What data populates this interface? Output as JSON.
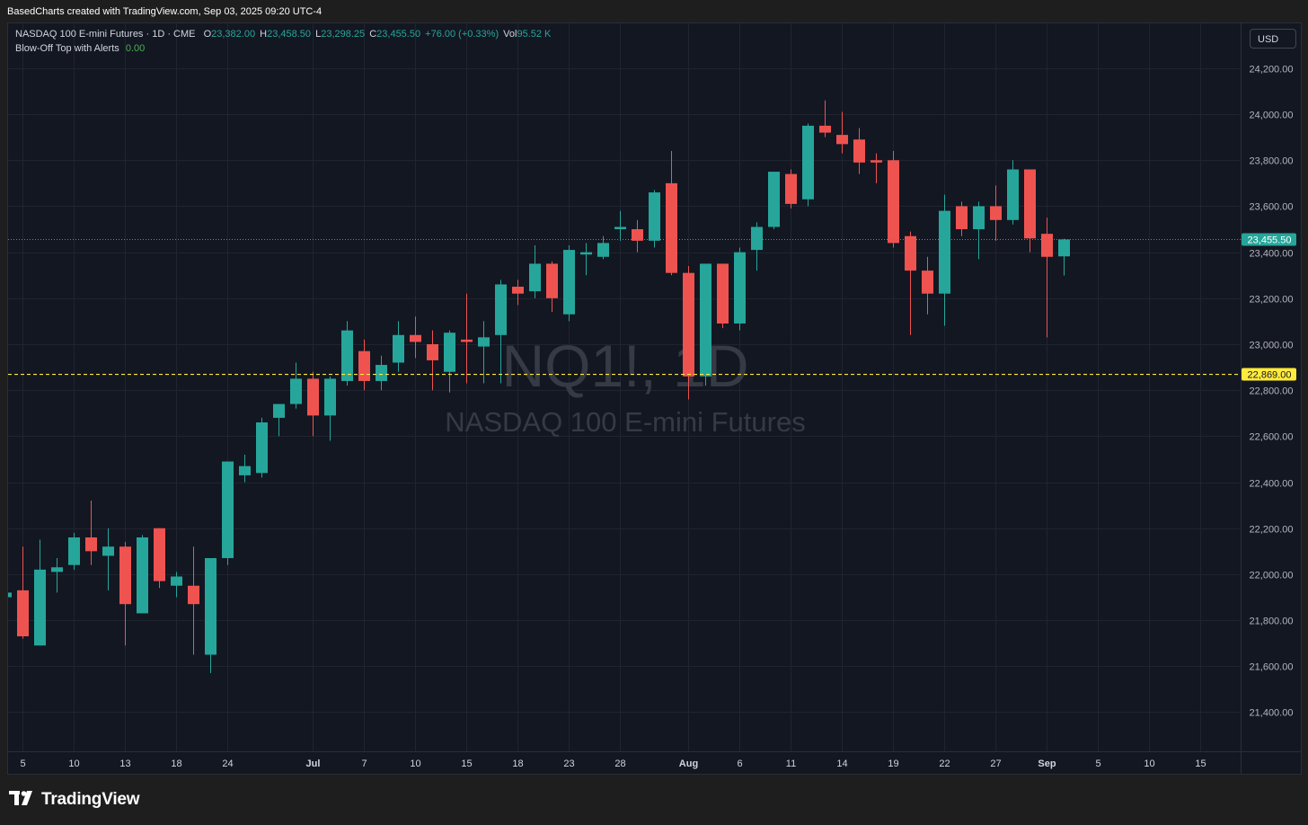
{
  "caption": "BasedCharts created with TradingView.com, Sep 03, 2025 09:20 UTC-4",
  "legend": {
    "symbol": "NASDAQ 100 E-mini Futures · 1D · CME",
    "open_label": "O",
    "open": "23,382.00",
    "high_label": "H",
    "high": "23,458.50",
    "low_label": "L",
    "low": "23,298.25",
    "close_label": "C",
    "close": "23,455.50",
    "change": "+76.00 (+0.33%)",
    "vol_label": "Vol",
    "vol": "95.52 K",
    "indicator": "Blow-Off Top with Alerts",
    "indicator_value": "0.00"
  },
  "currency": "USD",
  "watermark": {
    "ticker": "NQ1!, 1D",
    "name": "NASDAQ 100 E-mini Futures"
  },
  "brand": {
    "name": "TradingView",
    "logo_icon": "tradingview-logo-icon"
  },
  "colors": {
    "up": "#26a69a",
    "down": "#ef5350",
    "background": "#131722",
    "grid": "#1f2430",
    "axis_text": "#b2b5be",
    "alert_line": "#ffeb3b",
    "last_price": "#26a69a"
  },
  "chart_data": {
    "type": "candlestick",
    "price_axis": {
      "ticks": [
        21400,
        21600,
        21800,
        22000,
        22200,
        22400,
        22600,
        22800,
        23000,
        23200,
        23400,
        23600,
        23800,
        24000,
        24200
      ],
      "range": [
        21230,
        24395
      ]
    },
    "time_axis_labels": [
      {
        "label": "5",
        "bar": 1
      },
      {
        "label": "10",
        "bar": 4
      },
      {
        "label": "13",
        "bar": 7
      },
      {
        "label": "18",
        "bar": 10
      },
      {
        "label": "24",
        "bar": 13
      },
      {
        "label": "Jul",
        "bar": 18
      },
      {
        "label": "7",
        "bar": 21
      },
      {
        "label": "10",
        "bar": 24
      },
      {
        "label": "15",
        "bar": 27
      },
      {
        "label": "18",
        "bar": 30
      },
      {
        "label": "23",
        "bar": 33
      },
      {
        "label": "28",
        "bar": 36
      },
      {
        "label": "Aug",
        "bar": 40
      },
      {
        "label": "6",
        "bar": 43
      },
      {
        "label": "11",
        "bar": 46
      },
      {
        "label": "14",
        "bar": 49
      },
      {
        "label": "19",
        "bar": 52
      },
      {
        "label": "22",
        "bar": 55
      },
      {
        "label": "27",
        "bar": 58
      },
      {
        "label": "Sep",
        "bar": 61
      },
      {
        "label": "5",
        "bar": 64
      },
      {
        "label": "10",
        "bar": 67
      },
      {
        "label": "15",
        "bar": 70
      }
    ],
    "candles": [
      [
        21900,
        21950,
        21830,
        21920
      ],
      [
        21930,
        22120,
        21720,
        21730
      ],
      [
        21690,
        22150,
        21690,
        22020
      ],
      [
        22010,
        22070,
        21920,
        22030
      ],
      [
        22040,
        22180,
        22020,
        22160
      ],
      [
        22160,
        22320,
        22040,
        22100
      ],
      [
        22080,
        22200,
        21930,
        22120
      ],
      [
        22120,
        22140,
        21690,
        21870
      ],
      [
        21830,
        22170,
        21830,
        22160
      ],
      [
        22200,
        22200,
        21940,
        21970
      ],
      [
        21950,
        22010,
        21900,
        21990
      ],
      [
        21950,
        22120,
        21650,
        21870
      ],
      [
        21650,
        22070,
        21570,
        22070
      ],
      [
        22070,
        22440,
        22040,
        22490
      ],
      [
        22430,
        22520,
        22400,
        22470
      ],
      [
        22440,
        22680,
        22420,
        22660
      ],
      [
        22680,
        22740,
        22600,
        22740
      ],
      [
        22740,
        22920,
        22720,
        22850
      ],
      [
        22850,
        22880,
        22600,
        22690
      ],
      [
        22690,
        22860,
        22580,
        22850
      ],
      [
        22840,
        23100,
        22820,
        23060
      ],
      [
        22970,
        23020,
        22800,
        22840
      ],
      [
        22840,
        22950,
        22800,
        22910
      ],
      [
        22920,
        23100,
        22880,
        23040
      ],
      [
        23040,
        23120,
        22940,
        23010
      ],
      [
        23000,
        23060,
        22800,
        22930
      ],
      [
        22880,
        23060,
        22790,
        23050
      ],
      [
        23020,
        23220,
        22830,
        23010
      ],
      [
        22990,
        23100,
        22830,
        23030
      ],
      [
        23040,
        23280,
        22830,
        23260
      ],
      [
        23250,
        23280,
        23170,
        23220
      ],
      [
        23230,
        23430,
        23200,
        23350
      ],
      [
        23350,
        23360,
        23140,
        23200
      ],
      [
        23130,
        23430,
        23100,
        23410
      ],
      [
        23390,
        23440,
        23300,
        23400
      ],
      [
        23380,
        23470,
        23370,
        23440
      ],
      [
        23500,
        23580,
        23450,
        23510
      ],
      [
        23500,
        23540,
        23400,
        23450
      ],
      [
        23450,
        23670,
        23420,
        23660
      ],
      [
        23700,
        23840,
        23300,
        23310
      ],
      [
        23310,
        23340,
        22760,
        22860
      ],
      [
        22860,
        23340,
        22820,
        23350
      ],
      [
        23350,
        23350,
        23070,
        23090
      ],
      [
        23090,
        23420,
        23060,
        23400
      ],
      [
        23410,
        23530,
        23320,
        23510
      ],
      [
        23510,
        23670,
        23500,
        23750
      ],
      [
        23740,
        23760,
        23590,
        23610
      ],
      [
        23630,
        23960,
        23600,
        23950
      ],
      [
        23950,
        24060,
        23900,
        23920
      ],
      [
        23910,
        24010,
        23830,
        23870
      ],
      [
        23890,
        23940,
        23740,
        23790
      ],
      [
        23800,
        23830,
        23700,
        23790
      ],
      [
        23800,
        23840,
        23420,
        23440
      ],
      [
        23470,
        23490,
        23040,
        23320
      ],
      [
        23320,
        23380,
        23130,
        23220
      ],
      [
        23220,
        23650,
        23080,
        23580
      ],
      [
        23600,
        23620,
        23470,
        23500
      ],
      [
        23500,
        23620,
        23370,
        23600
      ],
      [
        23600,
        23690,
        23450,
        23540
      ],
      [
        23540,
        23800,
        23520,
        23760
      ],
      [
        23760,
        23760,
        23400,
        23460
      ],
      [
        23480,
        23550,
        23030,
        23380
      ],
      [
        23382,
        23458.5,
        23298.25,
        23455.5
      ]
    ],
    "last_price": {
      "value": 23455.5,
      "label": "23,455.50"
    },
    "alert_line": {
      "value": 22869,
      "label": "22,869.00"
    }
  }
}
